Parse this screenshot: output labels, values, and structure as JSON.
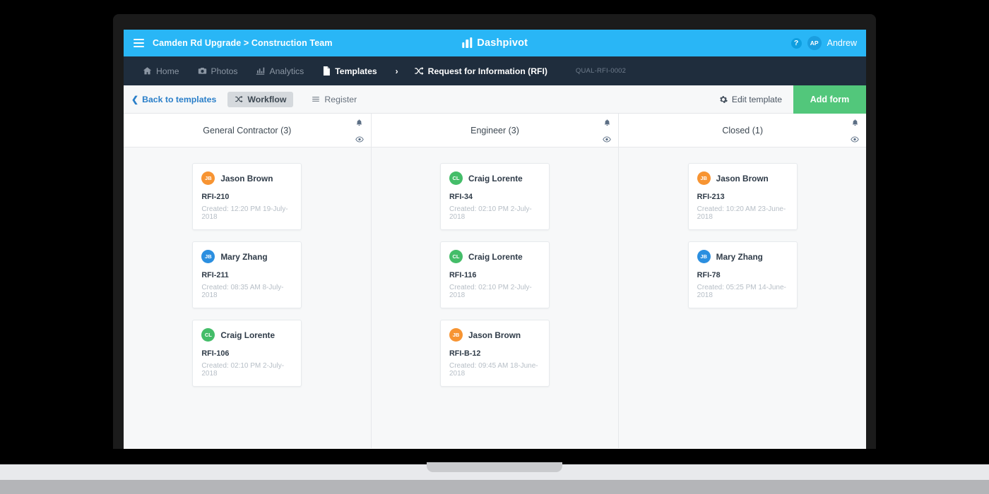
{
  "topbar": {
    "menu_icon": "hamburger-icon",
    "breadcrumb": "Camden Rd Upgrade > Construction Team",
    "brand": "Dashpivot",
    "help_label": "?",
    "user_initials": "AP",
    "user_name": "Andrew",
    "bg_color": "#29b6f6"
  },
  "navbar": {
    "bg_color": "#1f2d3d",
    "items": [
      {
        "label": "Home",
        "icon": "home-icon",
        "active": false
      },
      {
        "label": "Photos",
        "icon": "camera-icon",
        "active": false
      },
      {
        "label": "Analytics",
        "icon": "chart-icon",
        "active": false
      },
      {
        "label": "Templates",
        "icon": "document-icon",
        "active": true
      }
    ],
    "separator": "›",
    "current": {
      "label": "Request for Information (RFI)",
      "icon": "shuffle-icon"
    },
    "code": "QUAL-RFI-0002"
  },
  "toolbar": {
    "back_label": "Back to templates",
    "tabs": [
      {
        "label": "Workflow",
        "icon": "shuffle-icon",
        "active": true
      },
      {
        "label": "Register",
        "icon": "list-icon",
        "active": false
      }
    ],
    "edit_template_label": "Edit template",
    "add_form_label": "Add form",
    "add_form_color": "#52c77b",
    "link_color": "#2a7fc9"
  },
  "board": {
    "columns": [
      {
        "title": "General Contractor (3)",
        "bell_icon": "bell-icon",
        "eye_icon": "eye-icon",
        "cards": [
          {
            "user": "Jason Brown",
            "initials": "JB",
            "avatar_color": "#f79432",
            "id": "RFI-210",
            "created": "Created: 12:20 PM 19-July-2018"
          },
          {
            "user": "Mary Zhang",
            "initials": "JB",
            "avatar_color": "#2b8fe0",
            "id": "RFI-211",
            "created": "Created: 08:35 AM 8-July-2018"
          },
          {
            "user": "Craig Lorente",
            "initials": "CL",
            "avatar_color": "#44bd69",
            "id": "RFI-106",
            "created": "Created: 02:10 PM 2-July-2018"
          }
        ]
      },
      {
        "title": "Engineer (3)",
        "bell_icon": "bell-icon",
        "eye_icon": "eye-icon",
        "cards": [
          {
            "user": "Craig Lorente",
            "initials": "CL",
            "avatar_color": "#44bd69",
            "id": "RFI-34",
            "created": "Created: 02:10 PM 2-July-2018"
          },
          {
            "user": "Craig Lorente",
            "initials": "CL",
            "avatar_color": "#44bd69",
            "id": "RFI-116",
            "created": "Created: 02:10 PM 2-July-2018"
          },
          {
            "user": "Jason Brown",
            "initials": "JB",
            "avatar_color": "#f79432",
            "id": "RFI-B-12",
            "created": "Created: 09:45 AM 18-June-2018"
          }
        ]
      },
      {
        "title": "Closed (1)",
        "bell_icon": "bell-icon",
        "eye_icon": "eye-icon",
        "cards": [
          {
            "user": "Jason Brown",
            "initials": "JB",
            "avatar_color": "#f79432",
            "id": "RFI-213",
            "created": "Created: 10:20 AM 23-June-2018"
          },
          {
            "user": "Mary Zhang",
            "initials": "JB",
            "avatar_color": "#2b8fe0",
            "id": "RFI-78",
            "created": "Created: 05:25 PM 14-June-2018"
          }
        ]
      }
    ]
  }
}
